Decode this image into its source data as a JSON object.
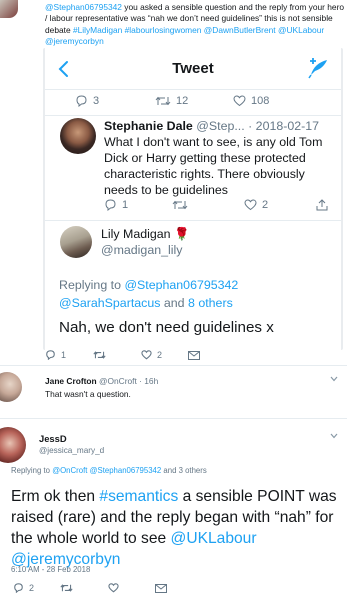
{
  "tweet1": {
    "text_parts": [
      {
        "t": "@Stephan06795342",
        "link": true
      },
      {
        "t": " you asked a sensible question and the reply from your hero / labour representative was “nah we don’t need guidelines” this is not sensible debate ",
        "link": false
      },
      {
        "t": "#LilyMadigan",
        "link": true
      },
      {
        "t": " ",
        "link": false
      },
      {
        "t": "#labourlosingwomen",
        "link": true
      },
      {
        "t": " ",
        "link": false
      },
      {
        "t": "@DawnButlerBrent",
        "link": true
      },
      {
        "t": " ",
        "link": false
      },
      {
        "t": "@UKLabour",
        "link": true
      },
      {
        "t": " ",
        "link": false
      },
      {
        "t": "@jeremycorbyn",
        "link": true
      }
    ],
    "retweets": "1",
    "likes": "2"
  },
  "card": {
    "title": "Tweet",
    "top_actions": {
      "replies": "3",
      "retweets": "12",
      "likes": "108"
    },
    "quoted": {
      "name": "Stephanie Dale",
      "handle_date": "@Step... · 2018-02-17",
      "text": "What I don't want to see, is any old Tom Dick or Harry getting these protected characteristic rights. There obviously needs to be guidelines",
      "replies": "1",
      "likes": "2"
    },
    "reply": {
      "name": "Lily Madigan",
      "rose": "🌹",
      "handle": "@madigan_lily",
      "replying_prefix": "Replying to ",
      "replying_to_1": "@Stephan06795342",
      "replying_to_2": "@SarahSpartacus",
      "replying_mid": " and ",
      "replying_others": "8 others",
      "text": "Nah, we don't need guidelines x"
    }
  },
  "tweet2": {
    "name": "Jane Crofton",
    "handle_time": "@OnCroft · 16h",
    "text": "That wasn't a question."
  },
  "tweet3": {
    "name": "JessD",
    "handle": "@jessica_mary_d",
    "replying_prefix": "Replying to ",
    "replying_to_1": "@OnCroft",
    "replying_to_2": "@Stephan06795342",
    "replying_suffix": " and 3 others",
    "text_parts": [
      {
        "t": "Erm ok then ",
        "link": false
      },
      {
        "t": "#semantics",
        "link": true
      },
      {
        "t": " a sensible POINT was raised (rare) and the reply began with “nah” for the whole world to see ",
        "link": false
      },
      {
        "t": "@UKLabour",
        "link": true
      },
      {
        "t": " ",
        "link": false
      },
      {
        "t": "@jeremycorbyn",
        "link": true
      }
    ],
    "timestamp": "6:10 AM - 28 Feb 2018",
    "retweets": "2"
  },
  "colors": {
    "accent": "#1da1f2",
    "muted": "#657786",
    "text": "#14171a",
    "like_red": "#e0245e"
  }
}
